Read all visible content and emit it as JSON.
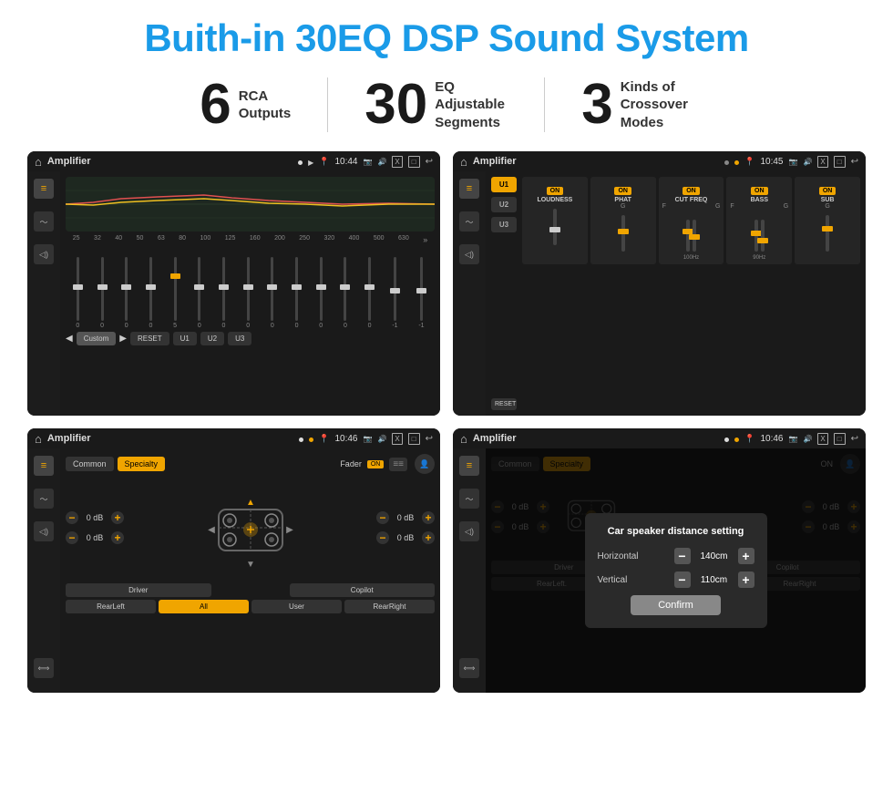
{
  "title": "Buith-in 30EQ DSP Sound System",
  "stats": [
    {
      "number": "6",
      "label": "RCA\nOutputs"
    },
    {
      "number": "30",
      "label": "EQ Adjustable\nSegments"
    },
    {
      "number": "3",
      "label": "Kinds of\nCrossover Modes"
    }
  ],
  "screens": [
    {
      "id": "screen-eq",
      "statusBar": {
        "title": "Amplifier",
        "time": "10:44"
      },
      "type": "eq"
    },
    {
      "id": "screen-crossover",
      "statusBar": {
        "title": "Amplifier",
        "time": "10:45"
      },
      "type": "crossover"
    },
    {
      "id": "screen-fader",
      "statusBar": {
        "title": "Amplifier",
        "time": "10:46"
      },
      "type": "fader"
    },
    {
      "id": "screen-dialog",
      "statusBar": {
        "title": "Amplifier",
        "time": "10:46"
      },
      "type": "dialog"
    }
  ],
  "eq": {
    "frequencies": [
      "25",
      "32",
      "40",
      "50",
      "63",
      "80",
      "100",
      "125",
      "160",
      "200",
      "250",
      "320",
      "400",
      "500",
      "630"
    ],
    "values": [
      "0",
      "0",
      "0",
      "0",
      "5",
      "0",
      "0",
      "0",
      "0",
      "0",
      "0",
      "0",
      "0",
      "-1",
      "0",
      "-1"
    ],
    "presets": [
      "Custom"
    ],
    "buttons": [
      "RESET",
      "U1",
      "U2",
      "U3"
    ]
  },
  "crossover": {
    "presets": [
      "U1",
      "U2",
      "U3"
    ],
    "controls": [
      "LOUDNESS",
      "PHAT",
      "CUT FREQ",
      "BASS",
      "SUB"
    ],
    "resetLabel": "RESET"
  },
  "fader": {
    "tabs": [
      "Common",
      "Specialty"
    ],
    "faderLabel": "Fader",
    "onLabel": "ON",
    "driverLabel": "Driver",
    "copilotLabel": "Copilot",
    "rearLeftLabel": "RearLeft",
    "allLabel": "All",
    "userLabel": "User",
    "rearRightLabel": "RearRight",
    "dbValues": [
      "0 dB",
      "0 dB",
      "0 dB",
      "0 dB"
    ]
  },
  "dialog": {
    "title": "Car speaker distance setting",
    "horizontal": {
      "label": "Horizontal",
      "value": "140cm"
    },
    "vertical": {
      "label": "Vertical",
      "value": "110cm"
    },
    "confirmLabel": "Confirm",
    "tabs": [
      "Common",
      "Specialty"
    ],
    "driverLabel": "Driver",
    "copilotLabel": "Copilot",
    "rearLeftLabel": "RearLeft.",
    "rearRightLabel": "RearRight",
    "dbRight1": "0 dB",
    "dbRight2": "0 dB"
  }
}
